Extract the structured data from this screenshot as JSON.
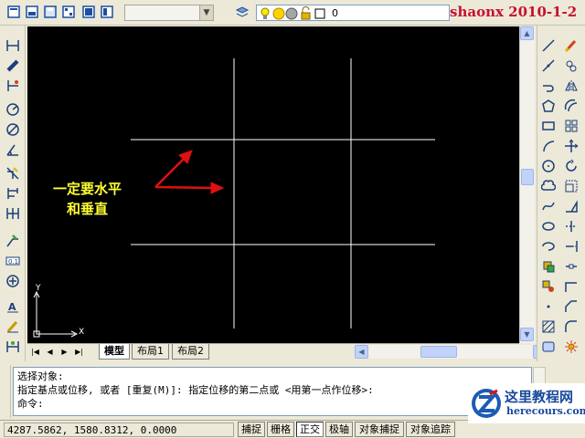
{
  "watermark": "shaonx 2010-1-2",
  "toolbar": {
    "style_combo_value": "",
    "layer_name": "0",
    "icons": [
      "new-file-icon",
      "open-file-icon",
      "save-icon",
      "print-icon",
      "style-icon",
      "layer-manager-icon",
      "bulb-icon",
      "sun-icon",
      "lock-icon",
      "color-swatch-icon"
    ]
  },
  "drawing": {
    "annotation_line1": "一定要水平",
    "annotation_line2": "和垂直",
    "ucs_x_label": "X",
    "ucs_y_label": "Y",
    "line_color": "#ffffff",
    "arrow_color": "#e01010",
    "text_color": "#ffff33",
    "background": "#000000"
  },
  "tabs": [
    {
      "label": "模型",
      "active": true
    },
    {
      "label": "布局1",
      "active": false
    },
    {
      "label": "布局2",
      "active": false
    }
  ],
  "left_tools": [
    "linear-dim-icon",
    "aligned-dim-icon",
    "ordinate-dim-icon",
    "radius-dim-icon",
    "diameter-dim-icon",
    "angular-dim-icon",
    "quick-dim-icon",
    "baseline-dim-icon",
    "continue-dim-icon",
    "leader-icon",
    "tolerance-icon",
    "center-mark-icon",
    "dim-edit-icon",
    "dim-text-edit-icon",
    "dim-update-icon"
  ],
  "right_tools_col1": [
    "line-icon",
    "construction-line-icon",
    "polyline-icon",
    "polygon-icon",
    "rectangle-icon",
    "arc-icon",
    "circle-icon",
    "revision-cloud-icon",
    "spline-icon",
    "ellipse-icon",
    "ellipse-arc-icon",
    "insert-block-icon",
    "make-block-icon",
    "point-icon",
    "hatch-icon",
    "region-icon"
  ],
  "right_tools_col2": [
    "erase-icon",
    "copy-icon",
    "mirror-icon",
    "offset-icon",
    "array-icon",
    "move-icon",
    "rotate-icon",
    "scale-icon",
    "stretch-icon",
    "trim-icon",
    "extend-icon",
    "break-icon",
    "join-icon",
    "chamfer-icon",
    "fillet-icon",
    "explode-icon"
  ],
  "command": {
    "line1": "选择对象:",
    "line2": "指定基点或位移, 或者 [重复(M)]: 指定位移的第二点或 <用第一点作位移>:",
    "line3": "命令:"
  },
  "status": {
    "coordinates": "4287.5862, 1580.8312, 0.0000",
    "buttons": [
      {
        "label": "捕捉",
        "on": false
      },
      {
        "label": "栅格",
        "on": false
      },
      {
        "label": "正交",
        "on": true
      },
      {
        "label": "极轴",
        "on": false
      },
      {
        "label": "对象捕捉",
        "on": false
      },
      {
        "label": "对象追踪",
        "on": false
      }
    ]
  },
  "logo": {
    "title": "这里教程网",
    "url": "herecours.com"
  }
}
